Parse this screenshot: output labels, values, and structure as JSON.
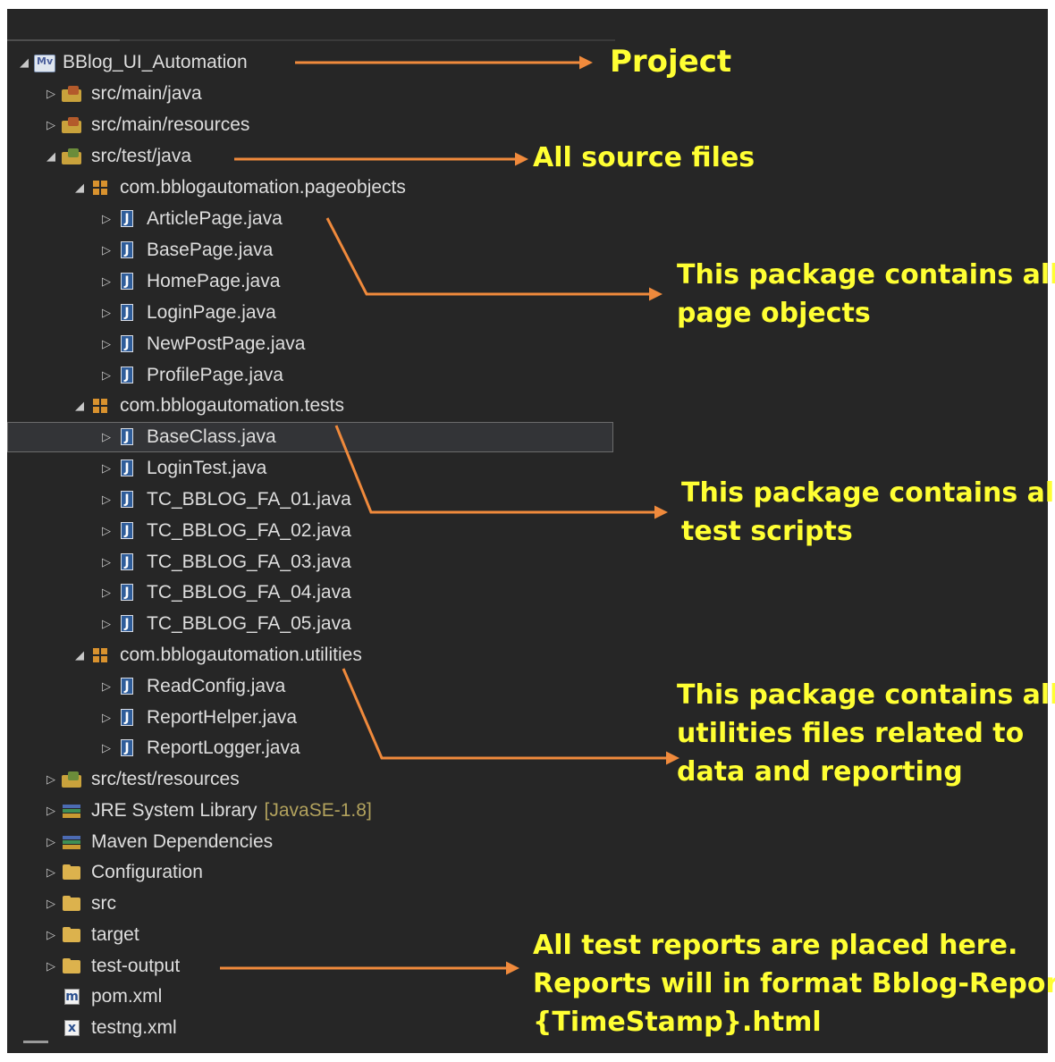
{
  "tree": {
    "project": "BBlog_UI_Automation",
    "src_main_java": "src/main/java",
    "src_main_resources": "src/main/resources",
    "src_test_java": "src/test/java",
    "pkg_pageobjects": "com.bblogautomation.pageobjects",
    "pageobjects_files": [
      "ArticlePage.java",
      "BasePage.java",
      "HomePage.java",
      "LoginPage.java",
      "NewPostPage.java",
      "ProfilePage.java"
    ],
    "pkg_tests": "com.bblogautomation.tests",
    "tests_files": [
      "BaseClass.java",
      "LoginTest.java",
      "TC_BBLOG_FA_01.java",
      "TC_BBLOG_FA_02.java",
      "TC_BBLOG_FA_03.java",
      "TC_BBLOG_FA_04.java",
      "TC_BBLOG_FA_05.java"
    ],
    "pkg_utilities": "com.bblogautomation.utilities",
    "utilities_files": [
      "ReadConfig.java",
      "ReportHelper.java",
      "ReportLogger.java"
    ],
    "src_test_resources": "src/test/resources",
    "jre_library": "JRE System Library",
    "jre_version": "[JavaSE-1.8]",
    "maven_dependencies": "Maven Dependencies",
    "folder_configuration": "Configuration",
    "folder_src": "src",
    "folder_target": "target",
    "folder_test_output": "test-output",
    "file_pom": "pom.xml",
    "file_testng": "testng.xml",
    "selected_item": "BaseClass.java"
  },
  "annotations": {
    "project": "Project",
    "source_files": "All source files",
    "pageobjects_line1": "This package contains all",
    "pageobjects_line2": "page objects",
    "tests_line1": "This package contains all",
    "tests_line2": "test scripts",
    "utilities_line1": "This package contains all",
    "utilities_line2": "utilities files related to",
    "utilities_line3": "data and reporting",
    "reports_line1": "All test reports are placed here.",
    "reports_line2": "Reports will in format Bblog-Report-",
    "reports_line3": "{TimeStamp}.html"
  },
  "icons": {
    "project": "maven-project-icon",
    "source_folder": "source-folder-icon",
    "package": "package-icon",
    "java_file": "java-file-icon",
    "library": "library-icon",
    "folder": "folder-icon",
    "maven_file": "maven-file-icon",
    "xml_file": "xml-file-icon"
  },
  "colors": {
    "background": "#262626",
    "text": "#dedede",
    "annotation_text": "#ffff33",
    "arrow": "#f08a3c",
    "decorator": "#b2a25d",
    "selection": "#333437"
  }
}
